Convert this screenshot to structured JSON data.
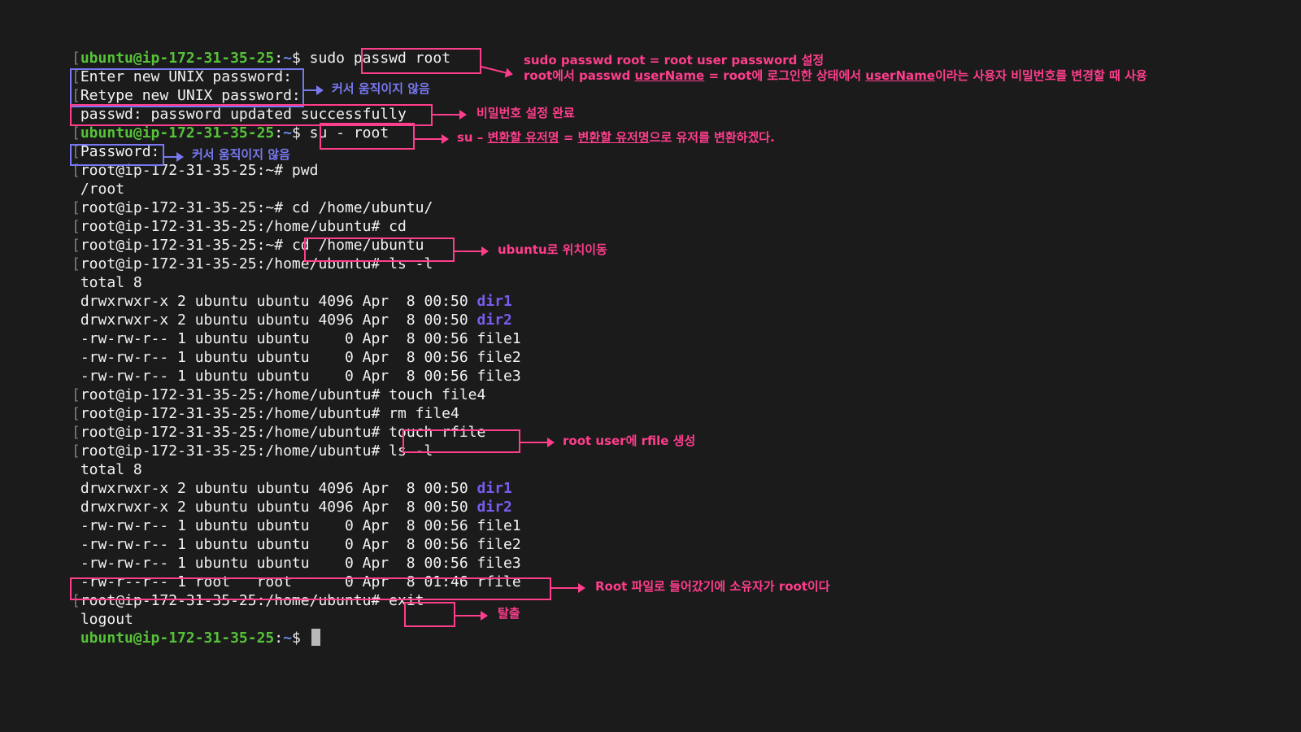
{
  "terminal": {
    "prompt_user": "ubuntu@ip-172-31-35-25",
    "prompt_root": "root@ip-172-31-35-25",
    "l1_sudo": "sudo ",
    "l1_passwd": "passwd root",
    "enter_pw": "Enter new UNIX password:",
    "retype_pw": "Retype new UNIX password:",
    "updated": "passwd: password updated successfully",
    "l5_cmd": "su - root",
    "password_prompt": "Password:",
    "l7": "root@ip-172-31-35-25:~# pwd",
    "l8": "/root",
    "l9": "root@ip-172-31-35-25:~# cd /home/ubuntu/",
    "l10": "root@ip-172-31-35-25:/home/ubuntu# cd",
    "l11_prefix": "root@ip-172-31-35-25:~# ",
    "l11_cmd": "cd /home/ubuntu",
    "l12": "root@ip-172-31-35-25:/home/ubuntu# ls -l",
    "total": "total 8",
    "ls1_dir1_prefix": "drwxrwxr-x 2 ubuntu ubuntu 4096 Apr  8 00:50 ",
    "dir1": "dir1",
    "ls1_dir2_prefix": "drwxrwxr-x 2 ubuntu ubuntu 4096 Apr  8 00:50 ",
    "dir2": "dir2",
    "ls1_file1": "-rw-rw-r-- 1 ubuntu ubuntu    0 Apr  8 00:56 file1",
    "ls1_file2": "-rw-rw-r-- 1 ubuntu ubuntu    0 Apr  8 00:56 file2",
    "ls1_file3": "-rw-rw-r-- 1 ubuntu ubuntu    0 Apr  8 00:56 file3",
    "l19": "root@ip-172-31-35-25:/home/ubuntu# touch file4",
    "l20": "root@ip-172-31-35-25:/home/ubuntu# rm file4",
    "l21_prefix": "root@ip-172-31-35-25:/home/ubuntu# ",
    "l21_cmd": "touch rfile",
    "l22": "root@ip-172-31-35-25:/home/ubuntu# ls -l",
    "rfile_row": "-rw-r--r-- 1 root   root      0 Apr  8 01:46 rfile",
    "l30_prefix": "root@ip-172-31-35-25:/home/ubuntu# ",
    "l30_cmd": "exit",
    "logout": "logout",
    "dollar": "$ ",
    "colon": ":",
    "tilde": "~",
    "bracket": "["
  },
  "annotations": {
    "passwd_line1": "sudo passwd root = root user password 설정",
    "passwd_line2_a": "root에서 passwd ",
    "passwd_line2_u1": "userName",
    "passwd_line2_b": " = root에 로그인한 상태에서 ",
    "passwd_line2_u2": "userName",
    "passwd_line2_c": "이라는 사용자 비밀번호를 변경할 때 사용",
    "cursor_note_1": "커서 움직이지 않음",
    "updated_note": "비밀번호 설정 완료",
    "su_a": "su – ",
    "su_u1": "변환할 유저명",
    "su_b": " = ",
    "su_u2": "변환할 유저명",
    "su_c": "으로 유저를 변환하겠다.",
    "cursor_note_2": "커서 움직이지 않음",
    "cd_note": "ubuntu로 위치이동",
    "rfile_note": "root user에 rfile 생성",
    "owner_note": "Root 파일로 들어갔기에 소유자가 root이다",
    "exit_note": "탈출"
  },
  "colors": {
    "background": "#1b1b1b",
    "prompt_green": "#56c238",
    "prompt_blue": "#6d88e8",
    "directory_purple": "#7b5cf0",
    "annotation_pink": "#ff3e8c",
    "annotation_blue": "#7878f0"
  }
}
